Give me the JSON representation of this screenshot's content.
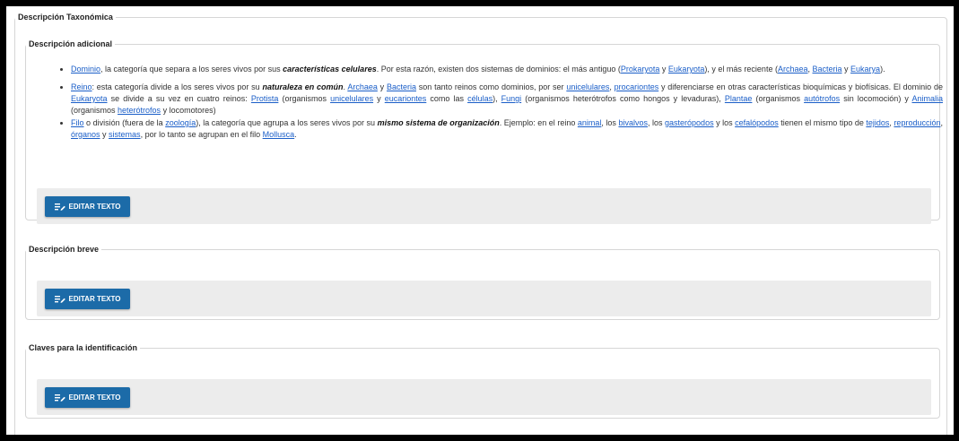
{
  "outer_legend": "Descripción Taxonómica",
  "sections": {
    "adicional": {
      "legend": "Descripción adicional"
    },
    "breve": {
      "legend": "Descripción breve"
    },
    "claves": {
      "legend": "Claves para la identificación"
    }
  },
  "edit_button_label": "EDITAR TEXTO",
  "edit_icon": "edit-text-icon",
  "accent_color": "#1c6ba8",
  "link_color": "#1a5ec8",
  "items": {
    "dominio": {
      "link_dominio": "Dominio",
      "t1": ", la categoría que separa a los seres vivos por sus ",
      "em": "características celulares",
      "t2": ". Por esta razón, existen dos sistemas de dominios: el más antiguo (",
      "link_prokaryota": "Prokaryota",
      "t3": " y ",
      "link_eukaryota": "Eukaryota",
      "t4": "), y el más reciente (",
      "link_archaea": "Archaea",
      "t5": ", ",
      "link_bacteria": "Bacteria",
      "t6": " y ",
      "link_eukarya": "Eukarya",
      "t7": ")."
    },
    "reino": {
      "link_reino": "Reino",
      "t1": ": esta categoría divide a los seres vivos por su ",
      "em": "naturaleza en común",
      "t2": ". ",
      "link_archaea": "Archaea",
      "t3": " y ",
      "link_bacteria": "Bacteria",
      "t4": " son tanto reinos como dominios, por ser ",
      "link_unicelulares": "unicelulares",
      "t5": ", ",
      "link_procariontes": "procariontes",
      "t6": " y diferenciarse en otras características bioquímicas y biofísicas. El dominio de ",
      "link_eukaryota": "Eukaryota",
      "t7": " se divide a su vez en cuatro reinos: ",
      "link_protista": "Protista",
      "t8": " (organismos ",
      "link_unicelulares2": "unicelulares",
      "t9": " y ",
      "link_eucariontes": "eucariontes",
      "t10": " como las ",
      "link_celulas": "células",
      "t11": "), ",
      "link_fungi": "Fungi",
      "t12": " (organismos heterótrofos como hongos y levaduras), ",
      "link_plantae": "Plantae",
      "t13": " (organismos ",
      "link_autotrofos": "autótrofos",
      "t14": " sin locomoción) y ",
      "link_animalia": "Animalia",
      "t15": " (organismos ",
      "link_heterotrofos": "heterótrofos",
      "t16": " y locomotores)"
    },
    "filo": {
      "link_filo": "Filo",
      "t1": " o división (fuera de la ",
      "link_zoologia": "zoología",
      "t2": "), la categoría que agrupa a los seres vivos por su ",
      "em": "mismo sistema de organización",
      "t3": ". Ejemplo: en el reino ",
      "link_animal": "animal",
      "t4": ", los ",
      "link_bivalvos": "bivalvos",
      "t5": ", los ",
      "link_gasteropodos": "gasterópodos",
      "t6": " y los ",
      "link_cefalopodos": "cefalópodos",
      "t7": " tienen el mismo tipo de ",
      "link_tejidos": "tejidos",
      "t8": ", ",
      "link_reproduccion": "reproducción",
      "t9": ", ",
      "link_organos": "órganos",
      "t10": " y ",
      "link_sistemas": "sistemas",
      "t11": ", por lo tanto se agrupan en el filo ",
      "link_mollusca": "Mollusca",
      "t12": "."
    }
  }
}
